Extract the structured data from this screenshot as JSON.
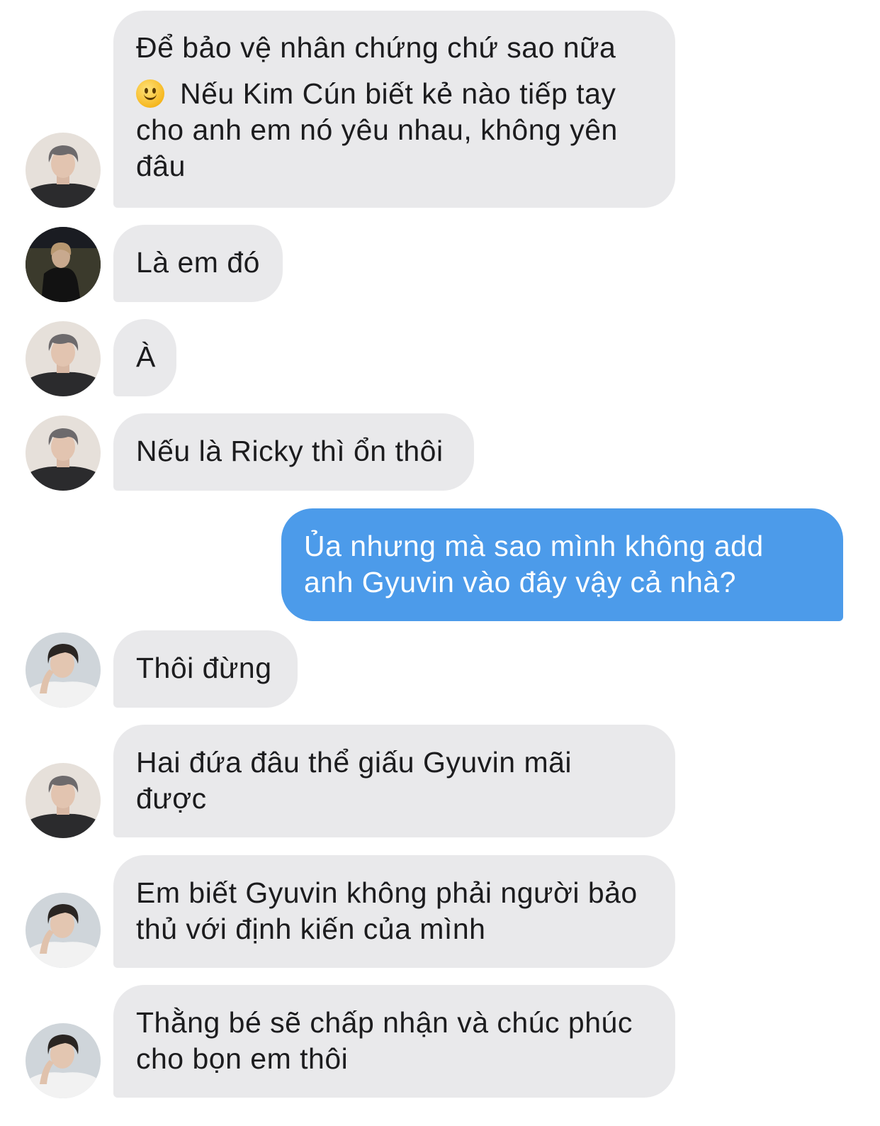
{
  "messages": [
    {
      "text_line1": "Để bảo vệ nhân chứng chứ sao nữa",
      "emoji": "slightly-smiling-face",
      "text_line2": "Nếu Kim Cún biết kẻ nào tiếp tay cho anh em nó yêu nhau, không yên đâu",
      "avatar": "gray-haired-boy-black-tee"
    },
    {
      "text": "Là em đó",
      "avatar": "night-silhouette-boy"
    },
    {
      "text": "À",
      "avatar": "gray-haired-boy-black-tee"
    },
    {
      "text": "Nếu là Ricky thì ổn thôi",
      "avatar": "gray-haired-boy-black-tee"
    },
    {
      "text": "Ủa nhưng mà sao mình không add anh Gyuvin vào đây vậy cả nhà?",
      "direction": "outgoing"
    },
    {
      "text": "Thôi đừng",
      "avatar": "dark-haired-boy-white-tee"
    },
    {
      "text": "Hai đứa đâu thể giấu Gyuvin mãi được",
      "avatar": "gray-haired-boy-black-tee"
    },
    {
      "text": "Em biết Gyuvin không phải người bảo thủ với định kiến của mình",
      "avatar": "dark-haired-boy-white-tee"
    },
    {
      "text": "Thằng bé sẽ chấp nhận và chúc phúc cho bọn em thôi",
      "avatar": "dark-haired-boy-white-tee"
    }
  ],
  "colors": {
    "incoming_bubble": "#e9e9eb",
    "outgoing_bubble": "#4c9bea"
  }
}
